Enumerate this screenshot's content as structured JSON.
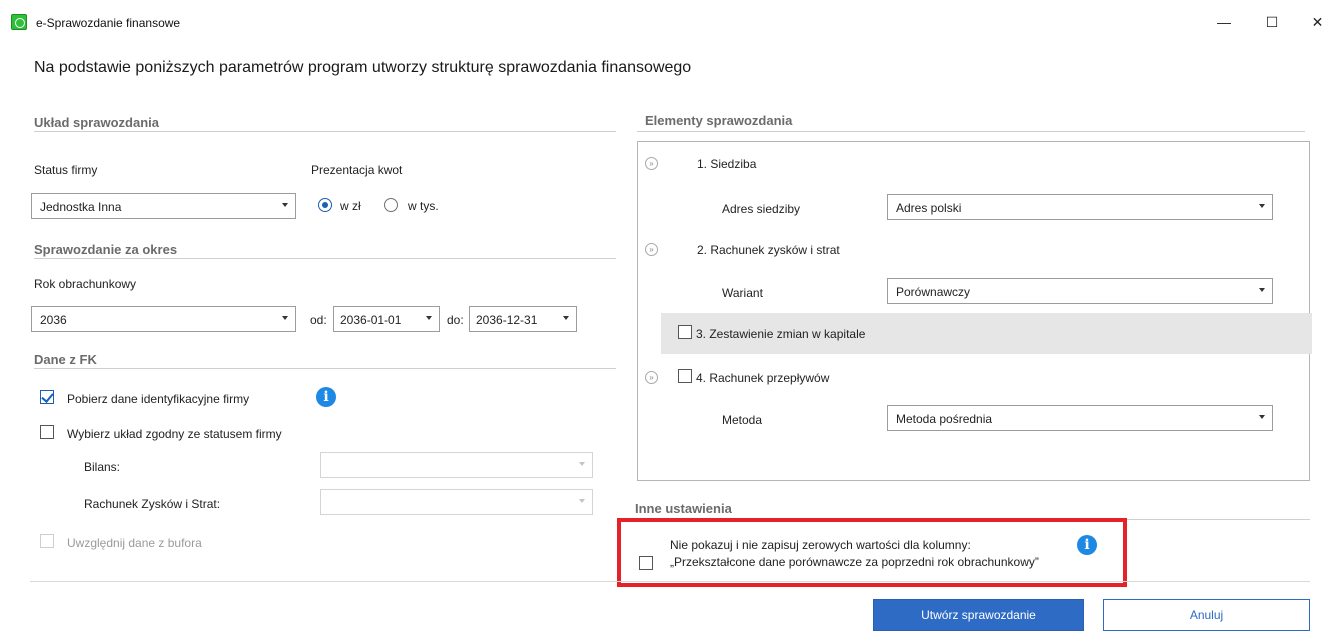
{
  "window": {
    "title": "e-Sprawozdanie finansowe",
    "controls": {
      "minimize": "—",
      "maximize": "☐",
      "close": "✕"
    }
  },
  "headline": "Na podstawie poniższych parametrów program utworzy strukturę sprawozdania finansowego",
  "left": {
    "uklad": {
      "title": "Układ sprawozdania",
      "status_label": "Status firmy",
      "status_value": "Jednostka Inna",
      "prezentacja_label": "Prezentacja kwot",
      "radio_zl": "w zł",
      "radio_tys": "w tys.",
      "selected": "w zł"
    },
    "okres": {
      "title": "Sprawozdanie za okres",
      "rok_label": "Rok obrachunkowy",
      "rok_value": "2036",
      "od_label": "od:",
      "od_value": "2036-01-01",
      "do_label": "do:",
      "do_value": "2036-12-31"
    },
    "fk": {
      "title": "Dane z FK",
      "pobierz_label": "Pobierz dane identyfikacyjne firmy",
      "pobierz_checked": true,
      "wybierz_label": "Wybierz układ zgodny ze statusem firmy",
      "wybierz_checked": false,
      "bilans_label": "Bilans:",
      "bilans_value": "",
      "rzis_label": "Rachunek Zysków i Strat:",
      "rzis_value": "",
      "bufor_label": "Uwzględnij dane z bufora",
      "bufor_checked": false
    }
  },
  "right": {
    "elementy": {
      "title": "Elementy sprawozdania",
      "items": [
        {
          "label": "1. Siedziba",
          "sub_label": "Adres siedziby",
          "sub_value": "Adres polski"
        },
        {
          "label": "2. Rachunek zysków i strat",
          "sub_label": "Wariant",
          "sub_value": "Porównawczy"
        },
        {
          "label": "3. Zestawienie zmian w kapitale",
          "checked": false
        },
        {
          "label": "4. Rachunek przepływów",
          "checked": false,
          "sub_label": "Metoda",
          "sub_value": "Metoda pośrednia"
        }
      ]
    },
    "inne": {
      "title": "Inne ustawienia",
      "line1": "Nie pokazuj i nie zapisuj zerowych wartości dla kolumny:",
      "line2": "„Przekształcone dane porównawcze za poprzedni rok obrachunkowy”",
      "checked": false
    }
  },
  "buttons": {
    "create": "Utwórz sprawozdanie",
    "cancel": "Anuluj"
  },
  "colors": {
    "accent": "#2e6bc4",
    "highlight_border": "#e3222a",
    "info": "#1e88e5"
  },
  "icons": {
    "info": "i",
    "collapse": "»"
  }
}
